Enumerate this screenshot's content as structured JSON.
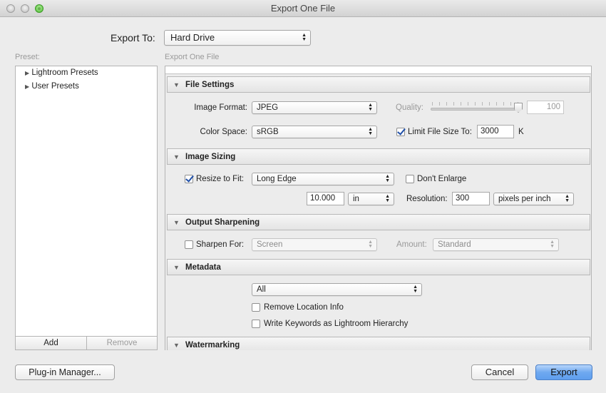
{
  "window": {
    "title": "Export One File"
  },
  "export_to": {
    "label": "Export To:",
    "value": "Hard Drive"
  },
  "preset": {
    "label": "Preset:",
    "items": [
      {
        "label": "Lightroom Presets"
      },
      {
        "label": "User Presets"
      }
    ],
    "add_label": "Add",
    "remove_label": "Remove"
  },
  "settings": {
    "title": "Export One File",
    "file_settings": {
      "header": "File Settings",
      "image_format_label": "Image Format:",
      "image_format_value": "JPEG",
      "quality_label": "Quality:",
      "quality_value": "100",
      "color_space_label": "Color Space:",
      "color_space_value": "sRGB",
      "limit_size_label": "Limit File Size To:",
      "limit_size_checked": true,
      "limit_size_value": "3000",
      "limit_size_unit": "K"
    },
    "image_sizing": {
      "header": "Image Sizing",
      "resize_label": "Resize to Fit:",
      "resize_checked": true,
      "resize_value": "Long Edge",
      "dont_enlarge_label": "Don't Enlarge",
      "size_value": "10.000",
      "size_unit": "in",
      "resolution_label": "Resolution:",
      "resolution_value": "300",
      "resolution_unit": "pixels per inch"
    },
    "output_sharpening": {
      "header": "Output Sharpening",
      "sharpen_label": "Sharpen For:",
      "sharpen_value": "Screen",
      "amount_label": "Amount:",
      "amount_value": "Standard"
    },
    "metadata": {
      "header": "Metadata",
      "include_value": "All",
      "remove_location_label": "Remove Location Info",
      "keywords_label": "Write Keywords as Lightroom Hierarchy"
    },
    "watermarking": {
      "header": "Watermarking"
    }
  },
  "buttons": {
    "plugin_manager": "Plug-in Manager...",
    "cancel": "Cancel",
    "export": "Export"
  },
  "icons": {
    "triangle_right": "▶",
    "triangle_down": "▼",
    "popup_arrows": "▲▼"
  }
}
